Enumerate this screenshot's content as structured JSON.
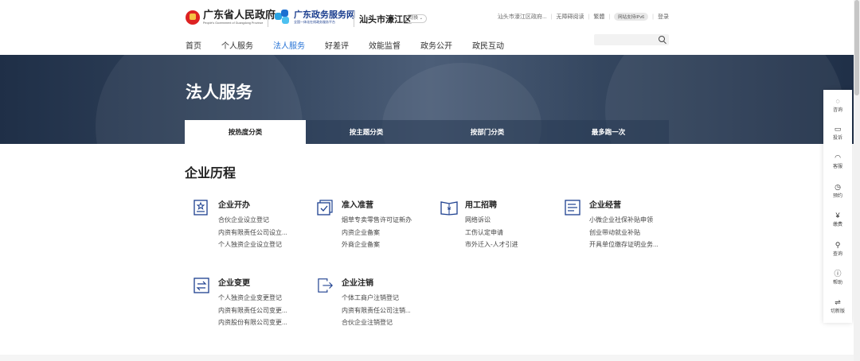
{
  "header": {
    "gov_title": "广东省人民政府",
    "gov_subtitle": "People's Government of Guangdong Province",
    "service_title": "广东政务服务网",
    "service_subtitle": "全国一体化在线政务服务平台",
    "region": "汕头市濠江区",
    "switch_label": "切换",
    "top_links": [
      "汕头市濠江区政府...",
      "无障碍阅读",
      "繁體",
      "网站支持IPv6",
      "登录"
    ]
  },
  "nav": [
    "首页",
    "个人服务",
    "法人服务",
    "好差评",
    "效能监督",
    "政务公开",
    "政民互动"
  ],
  "nav_active": "法人服务",
  "search": {
    "placeholder": ""
  },
  "banner": {
    "title": "法人服务"
  },
  "tabs": [
    {
      "label": "按热度分类",
      "active": true
    },
    {
      "label": "按主题分类",
      "active": false
    },
    {
      "label": "按部门分类",
      "active": false
    },
    {
      "label": "最多跑一次",
      "active": false
    }
  ],
  "section_title": "企业历程",
  "categories": [
    {
      "name": "企业开办",
      "icon": "certificate-icon",
      "items": [
        "合伙企业设立登记",
        "内资有限责任公司设立...",
        "个人独资企业设立登记"
      ]
    },
    {
      "name": "准入准营",
      "icon": "checked-document-icon",
      "items": [
        "烟草专卖零售许可证新办",
        "内资企业备案",
        "外商企业备案"
      ]
    },
    {
      "name": "用工招聘",
      "icon": "yuan-book-icon",
      "items": [
        "网络诉讼",
        "工伤认定申请",
        "市外迁入-人才引进"
      ]
    },
    {
      "name": "企业经营",
      "icon": "list-document-icon",
      "items": [
        "小微企业社保补贴申领",
        "创业带动就业补贴",
        "开具单位缴存证明业务..."
      ]
    },
    {
      "name": "企业变更",
      "icon": "swap-icon",
      "items": [
        "个人独资企业变更登记",
        "内资有限责任公司变更...",
        "内资股份有限公司变更..."
      ]
    },
    {
      "name": "企业注销",
      "icon": "exit-icon",
      "items": [
        "个体工商户注销登记",
        "内资有限责任公司注销...",
        "合伙企业注销登记"
      ]
    }
  ],
  "sidebar": [
    {
      "label": "咨询",
      "icon": "chat-icon",
      "glyph": "◌"
    },
    {
      "label": "投诉",
      "icon": "complaint-icon",
      "glyph": "▭"
    },
    {
      "label": "客服",
      "icon": "headset-icon",
      "glyph": "◠"
    },
    {
      "label": "预约",
      "icon": "clock-icon",
      "glyph": "◷"
    },
    {
      "label": "缴费",
      "icon": "payment-icon",
      "glyph": "¥"
    },
    {
      "label": "查询",
      "icon": "search-icon",
      "glyph": "⚲"
    },
    {
      "label": "帮助",
      "icon": "info-icon",
      "glyph": "ⓘ"
    },
    {
      "label": "切新版",
      "icon": "switch-version-icon",
      "glyph": "⇌"
    }
  ],
  "colors": {
    "accent": "#2673d6",
    "banner": "#2b3d57",
    "icon_blue": "#1c3f8f"
  }
}
